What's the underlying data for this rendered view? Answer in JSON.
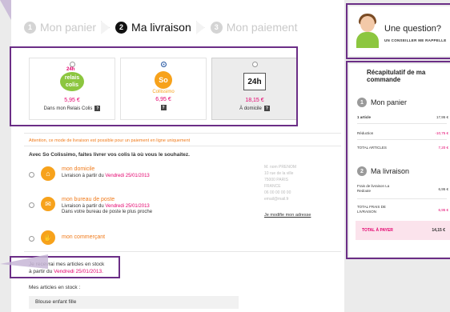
{
  "steps": [
    {
      "num": "1",
      "label": "Mon panier"
    },
    {
      "num": "2",
      "label": "Ma livraison"
    },
    {
      "num": "3",
      "label": "Mon paiement"
    }
  ],
  "delivery_options": [
    {
      "price": "5,95 €",
      "label": "Dans mon Relais Colis",
      "help": "?",
      "logo_badge": "24h",
      "logo_text": "relais colis"
    },
    {
      "price": "6,95 €",
      "label": "",
      "help": "?",
      "logo_text": "So",
      "logo_label": "Collissimo"
    },
    {
      "price": "18,15 €",
      "label": "À domicile",
      "help": "?",
      "logo_text": "24h"
    }
  ],
  "notice": "Attention, ce mode de livraison est possible pour un paiement en ligne uniquement",
  "intro": "Avec So Colissimo, faites livrer vos colis là où vous le souhaitez.",
  "home_options": [
    {
      "title": "mon domicile",
      "line": "Livraison à partir du",
      "date": "Vendredi 25/01/2013",
      "extra": ""
    },
    {
      "title": "mon bureau de poste",
      "line": "Livraison à partir du",
      "date": "Vendredi 25/01/2013",
      "extra": "Dans votre bureau de poste le plus proche"
    },
    {
      "title": "mon commerçant",
      "line": "",
      "date": "",
      "extra": ""
    }
  ],
  "address_lines": [
    "M. nom PRENOM",
    "10 rue de la ville",
    "75000 PARIS",
    "FRANCE",
    "06 00 00 00 00",
    "email@mail.fr"
  ],
  "address_link": "Je modifie mon adresse",
  "receive": {
    "line1": "Je recevrai mes articles en stock",
    "prefix": "à partir du",
    "date": "Vendredi 25/01/2013."
  },
  "stock_label": "Mes articles en stock :",
  "article": "Blouse enfant fille",
  "help": {
    "title": "Une question?",
    "button": "UN CONSEILLER ME RAPPELLE"
  },
  "recap": {
    "title": "Récapitulatif de ma commande",
    "cart_title": "Mon panier",
    "cart_num": "1",
    "articles_label": "1 article",
    "articles_value": "17,95 €",
    "reduction_label": "Réduction",
    "reduction_value": "-10,75 €",
    "total_articles_label": "TOTAL ARTICLES",
    "total_articles_value": "7,20 €",
    "delivery_title": "Ma livraison",
    "delivery_num": "2",
    "fees_label": "Frais de livraison La Redoute",
    "fees_value": "6,95 €",
    "total_fees_label": "TOTAL FRAIS DE LIVRAISON",
    "total_fees_value": "6,95 €",
    "total_label": "TOTAL À PAYER",
    "total_value": "14,15 €"
  }
}
